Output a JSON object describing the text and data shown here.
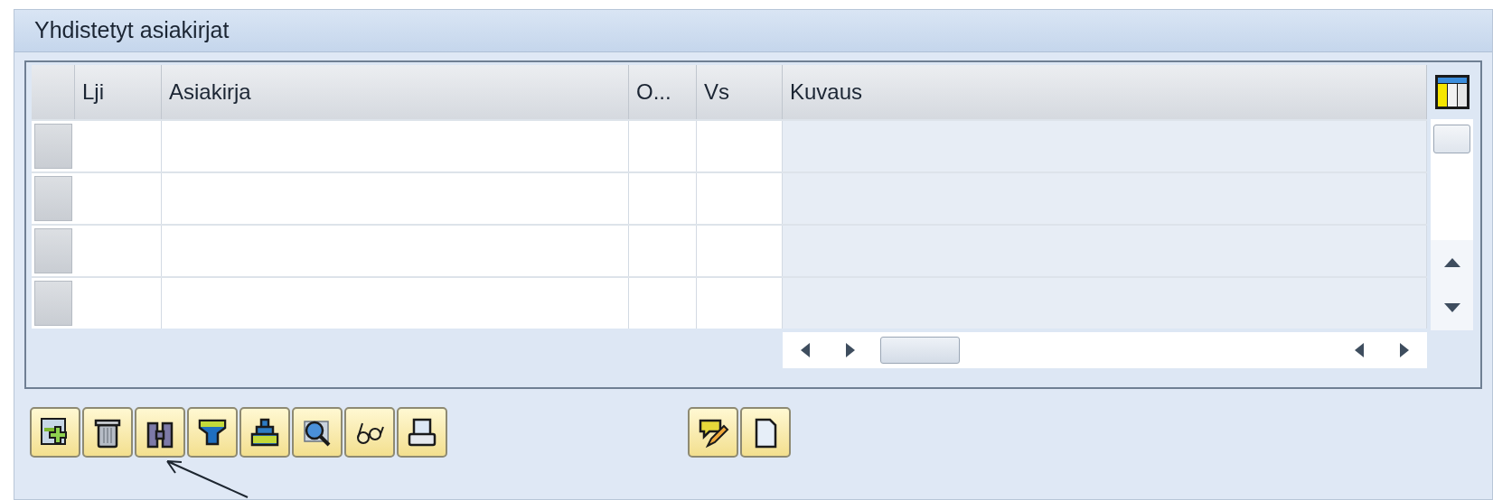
{
  "panel": {
    "title": "Yhdistetyt asiakirjat"
  },
  "table": {
    "columns": [
      {
        "label": "Lji",
        "editable": true
      },
      {
        "label": "Asiakirja",
        "editable": true
      },
      {
        "label": "O...",
        "editable": true
      },
      {
        "label": "Vs",
        "editable": true
      },
      {
        "label": "Kuvaus",
        "editable": false
      }
    ],
    "rows": [
      {
        "selected": false
      },
      {
        "selected": false
      },
      {
        "selected": false
      },
      {
        "selected": false
      }
    ]
  },
  "toolbar": {
    "left": [
      {
        "kind": "add-row"
      },
      {
        "kind": "delete"
      },
      {
        "kind": "find"
      },
      {
        "kind": "filter"
      },
      {
        "kind": "sort"
      },
      {
        "kind": "zoom"
      },
      {
        "kind": "glasses"
      },
      {
        "kind": "print"
      }
    ],
    "right": [
      {
        "kind": "edit-note"
      },
      {
        "kind": "new-document"
      }
    ]
  }
}
